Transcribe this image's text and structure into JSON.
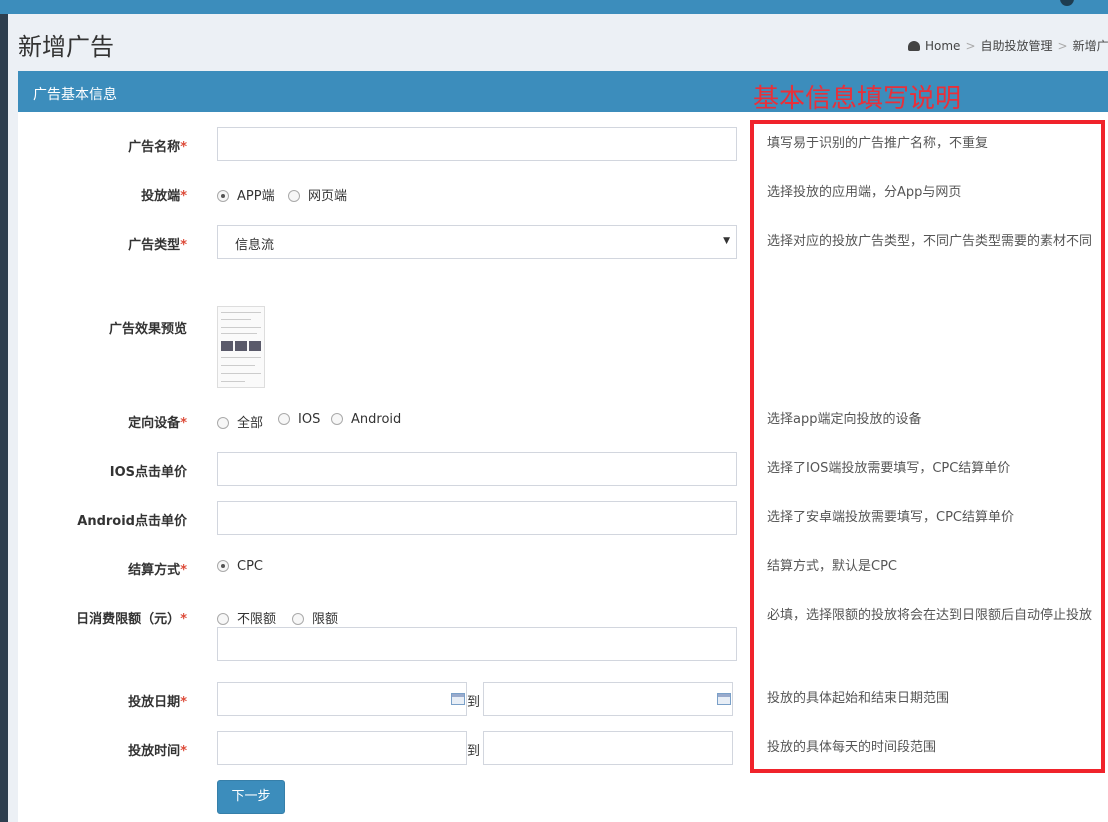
{
  "header": {
    "page_title": "新增广告",
    "breadcrumb": [
      "Home",
      "自助投放管理",
      "新增广告"
    ]
  },
  "box": {
    "title": "广告基本信息"
  },
  "help_panel": {
    "heading": "基本信息填写说明"
  },
  "form": {
    "ad_name": {
      "label": "广告名称",
      "value": "",
      "help": "填写易于识别的广告推广名称，不重复"
    },
    "platform": {
      "label": "投放端",
      "options": [
        "APP端",
        "网页端"
      ],
      "selected": "APP端",
      "help": "选择投放的应用端，分App与网页"
    },
    "ad_type": {
      "label": "广告类型",
      "value": "信息流",
      "help": "选择对应的投放广告类型，不同广告类型需要的素材不同"
    },
    "preview": {
      "label": "广告效果预览"
    },
    "target_device": {
      "label": "定向设备",
      "options": [
        "全部",
        "IOS",
        "Android"
      ],
      "selected": null,
      "help": "选择app端定向投放的设备"
    },
    "ios_cpc": {
      "label": "IOS点击单价",
      "value": "",
      "help": "选择了IOS端投放需要填写，CPC结算单价"
    },
    "android_cpc": {
      "label": "Android点击单价",
      "value": "",
      "help": "选择了安卓端投放需要填写，CPC结算单价"
    },
    "billing": {
      "label": "结算方式",
      "options": [
        "CPC"
      ],
      "selected": "CPC",
      "help": "结算方式，默认是CPC"
    },
    "daily_limit": {
      "label": "日消费限额（元）",
      "options": [
        "不限额",
        "限额"
      ],
      "selected": null,
      "value": "",
      "help": "必填，选择限额的投放将会在达到日限额后自动停止投放"
    },
    "date_range": {
      "label": "投放日期",
      "start": "",
      "end": "",
      "separator": "到",
      "help": "投放的具体起始和结束日期范围"
    },
    "time_range": {
      "label": "投放时间",
      "start": "",
      "end": "",
      "separator": "到",
      "help": "投放的具体每天的时间段范围"
    }
  },
  "actions": {
    "next_label": "下一步"
  },
  "colors": {
    "primary": "#3c8dbc",
    "required": "#dd4b39",
    "annotation": "#f0232b"
  }
}
